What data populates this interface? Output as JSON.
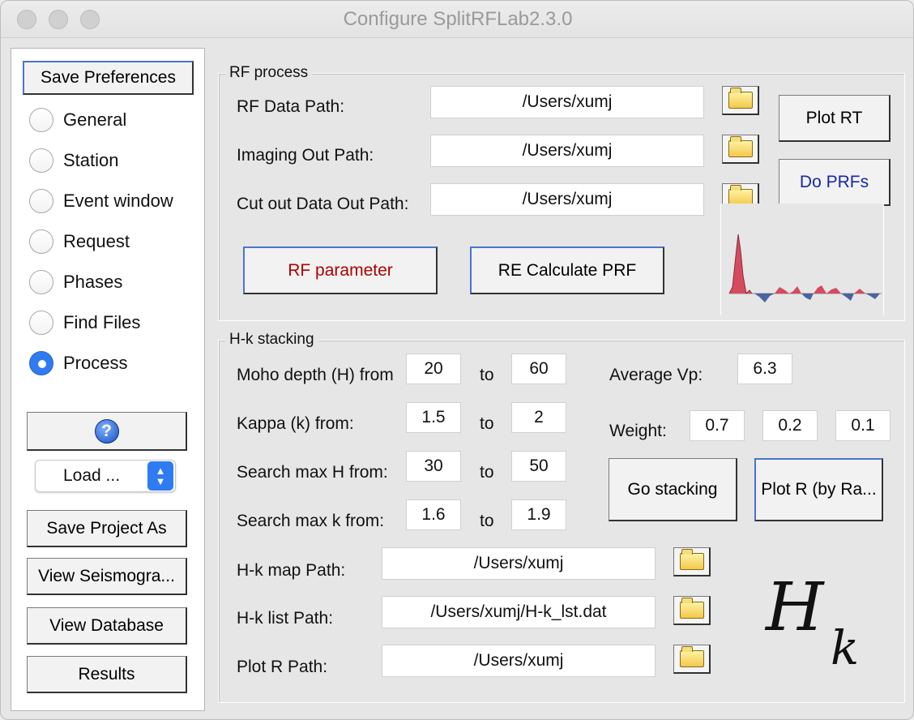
{
  "window": {
    "title": "Configure SplitRFLab2.3.0"
  },
  "left": {
    "save_preferences": "Save Preferences",
    "radios": [
      {
        "label": "General",
        "selected": false
      },
      {
        "label": "Station",
        "selected": false
      },
      {
        "label": "Event window",
        "selected": false
      },
      {
        "label": "Request",
        "selected": false
      },
      {
        "label": "Phases",
        "selected": false
      },
      {
        "label": "Find Files",
        "selected": false
      },
      {
        "label": "Process",
        "selected": true
      }
    ],
    "load_dropdown": "Load ...",
    "buttons": [
      "Save Project As",
      "View Seismogra...",
      "View Database",
      "Results"
    ],
    "help_icon": "question-mark-icon"
  },
  "rf_process": {
    "title": "RF process",
    "rows": [
      {
        "label": "RF Data Path:",
        "value": "/Users/xumj"
      },
      {
        "label": "Imaging Out Path:",
        "value": "/Users/xumj"
      },
      {
        "label": "Cut out Data Out Path:",
        "value": "/Users/xumj"
      }
    ],
    "buttons": {
      "plot_rt": "Plot RT",
      "do_prfs": "Do PRFs",
      "rf_parameter": "RF parameter",
      "re_calculate": "RE Calculate PRF"
    }
  },
  "hk": {
    "title": "H-k stacking",
    "to_label": "to",
    "rows": [
      {
        "label": "Moho depth (H) from",
        "from": "20",
        "to": "60"
      },
      {
        "label": "Kappa (k) from:",
        "from": "1.5",
        "to": "2"
      },
      {
        "label": "Search max H from:",
        "from": "30",
        "to": "50"
      },
      {
        "label": "Search max k from:",
        "from": "1.6",
        "to": "1.9"
      }
    ],
    "avg_vp_label": "Average Vp:",
    "avg_vp": "6.3",
    "weight_label": "Weight:",
    "weights": [
      "0.7",
      "0.2",
      "0.1"
    ],
    "go_stacking": "Go stacking",
    "plot_r": "Plot R (by Ra...",
    "paths": [
      {
        "label": "H-k map Path:",
        "value": "/Users/xumj"
      },
      {
        "label": "H-k list Path:",
        "value": "/Users/xumj/H-k_lst.dat"
      },
      {
        "label": "Plot R Path:",
        "value": "/Users/xumj"
      }
    ],
    "logo_text": [
      "H",
      "k"
    ]
  },
  "colors": {
    "accent": "#2f7bf2",
    "red_text": "#b00000",
    "blue_text": "#1728a8",
    "positive_fill": "#d64a5f",
    "negative_fill": "#49649f"
  }
}
